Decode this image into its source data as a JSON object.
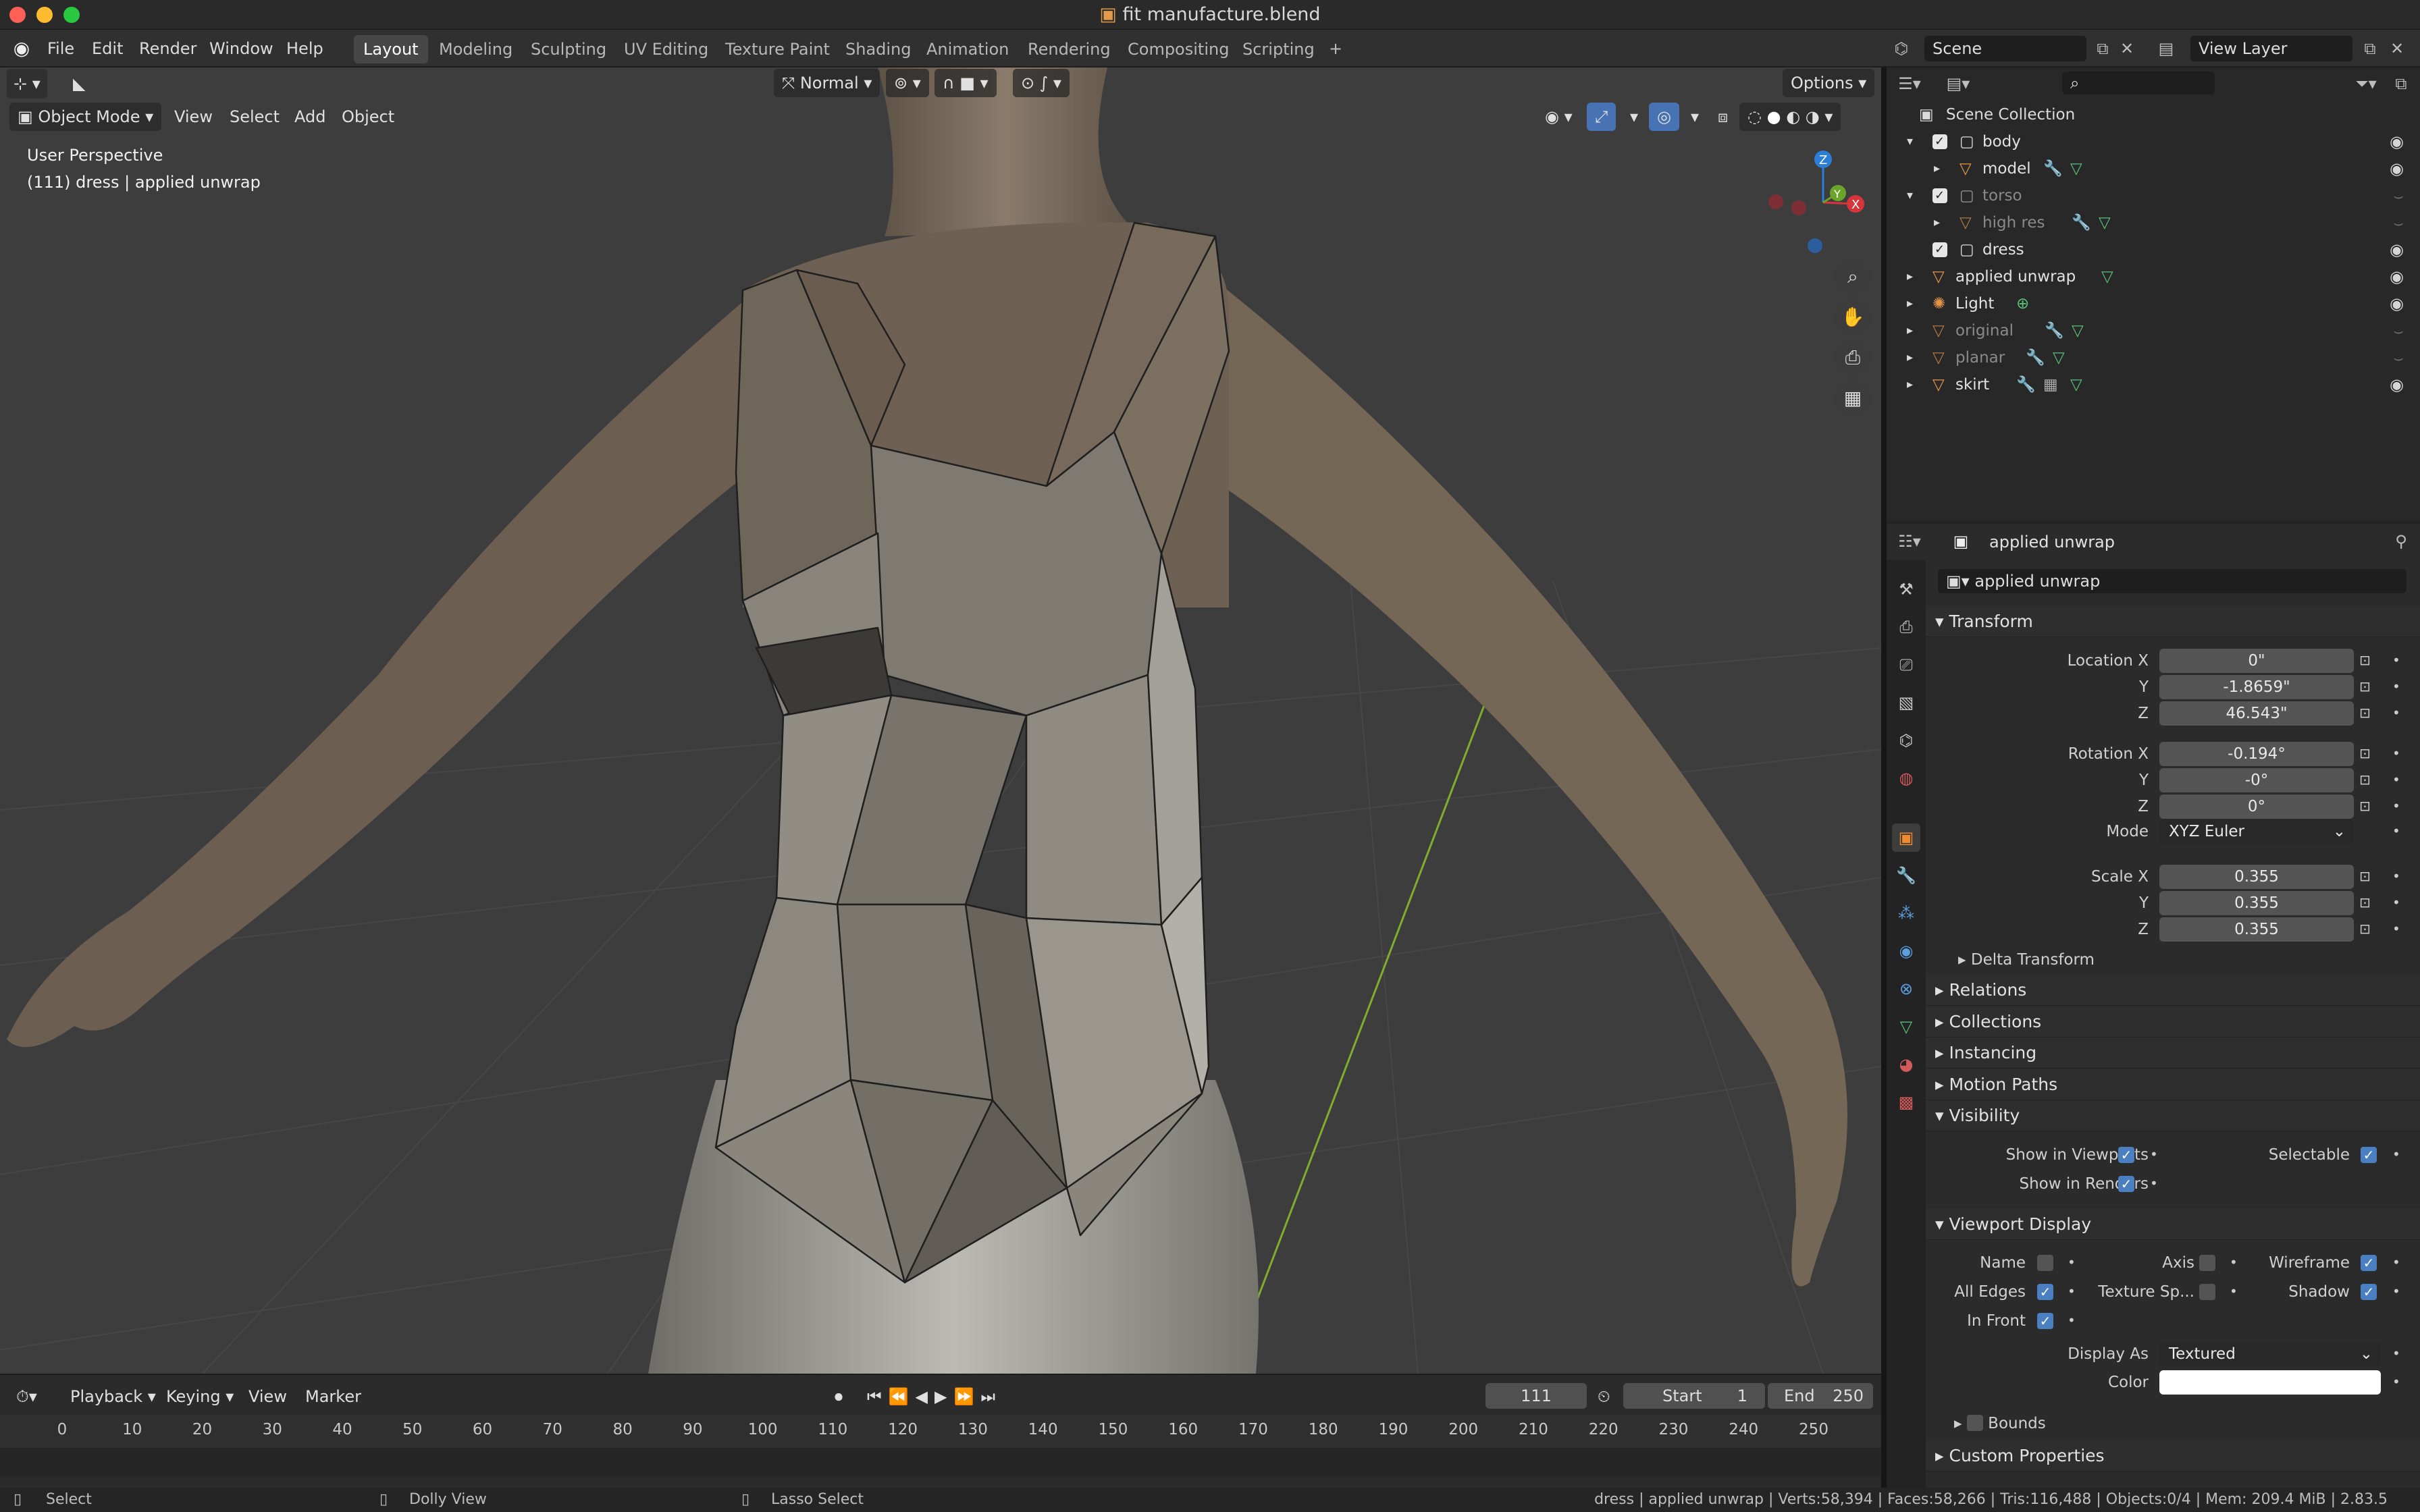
{
  "window": {
    "title": "fit manufacture.blend"
  },
  "menu": [
    "File",
    "Edit",
    "Render",
    "Window",
    "Help"
  ],
  "workspaces": [
    "Layout",
    "Modeling",
    "Sculpting",
    "UV Editing",
    "Texture Paint",
    "Shading",
    "Animation",
    "Rendering",
    "Compositing",
    "Scripting"
  ],
  "scene": {
    "label": "Scene",
    "view_layer": "View Layer"
  },
  "viewport": {
    "mode": "Object Mode",
    "menus": [
      "View",
      "Select",
      "Add",
      "Object"
    ],
    "orientation": "Normal",
    "options": "Options",
    "perspective_label": "User Perspective",
    "object_info": "(111) dress | applied unwrap",
    "gizmo": {
      "x": "X",
      "y": "Y",
      "z": "Z"
    }
  },
  "outliner": {
    "root": "Scene Collection",
    "items": [
      {
        "name": "body",
        "dim": false
      },
      {
        "name": "model",
        "dim": false
      },
      {
        "name": "torso",
        "dim": true
      },
      {
        "name": "high res",
        "dim": true
      },
      {
        "name": "dress",
        "dim": false
      },
      {
        "name": "applied unwrap",
        "dim": false
      },
      {
        "name": "Light",
        "dim": false
      },
      {
        "name": "original",
        "dim": true
      },
      {
        "name": "planar",
        "dim": true
      },
      {
        "name": "skirt",
        "dim": false
      }
    ]
  },
  "properties": {
    "object_name": "applied unwrap",
    "object_field": "applied unwrap",
    "transform": {
      "title": "Transform",
      "location_label": "Location X",
      "rotation_label": "Rotation X",
      "scale_label": "Scale X",
      "y_label": "Y",
      "z_label": "Z",
      "location": [
        "0\"",
        "-1.8659\"",
        "46.543\""
      ],
      "rotation": [
        "-0.194°",
        "-0°",
        "0°"
      ],
      "mode_label": "Mode",
      "mode": "XYZ Euler",
      "scale": [
        "0.355",
        "0.355",
        "0.355"
      ],
      "delta": "Delta Transform"
    },
    "sections": [
      "Relations",
      "Collections",
      "Instancing",
      "Motion Paths"
    ],
    "visibility": {
      "title": "Visibility",
      "show_viewports": "Show in Viewports",
      "selectable": "Selectable",
      "show_renders": "Show in Renders"
    },
    "viewport_display": {
      "title": "Viewport Display",
      "name": "Name",
      "axis": "Axis",
      "wireframe": "Wireframe",
      "all_edges": "All Edges",
      "texture_space": "Texture Sp...",
      "shadow": "Shadow",
      "in_front": "In Front",
      "display_as_label": "Display As",
      "display_as": "Textured",
      "color_label": "Color",
      "bounds": "Bounds"
    },
    "custom": "Custom Properties"
  },
  "timeline": {
    "menus": [
      "Playback",
      "Keying",
      "View",
      "Marker"
    ],
    "current_frame": "111",
    "start_label": "Start",
    "start": "1",
    "end_label": "End",
    "end": "250",
    "ticks": [
      "0",
      "10",
      "20",
      "30",
      "40",
      "50",
      "60",
      "70",
      "80",
      "90",
      "100",
      "110",
      "120",
      "130",
      "140",
      "150",
      "160",
      "170",
      "180",
      "190",
      "200",
      "210",
      "220",
      "230",
      "240",
      "250"
    ]
  },
  "status": {
    "select": "Select",
    "dolly": "Dolly View",
    "lasso": "Lasso Select",
    "info": "dress | applied unwrap | Verts:58,394 | Faces:58,266 | Tris:116,488 | Objects:0/4 | Mem: 209.4 MiB | 2.83.5"
  },
  "colors": {
    "accent": "#4a7fc1",
    "active_frame": "#4772b3",
    "mesh_orange": "#e8954a"
  }
}
